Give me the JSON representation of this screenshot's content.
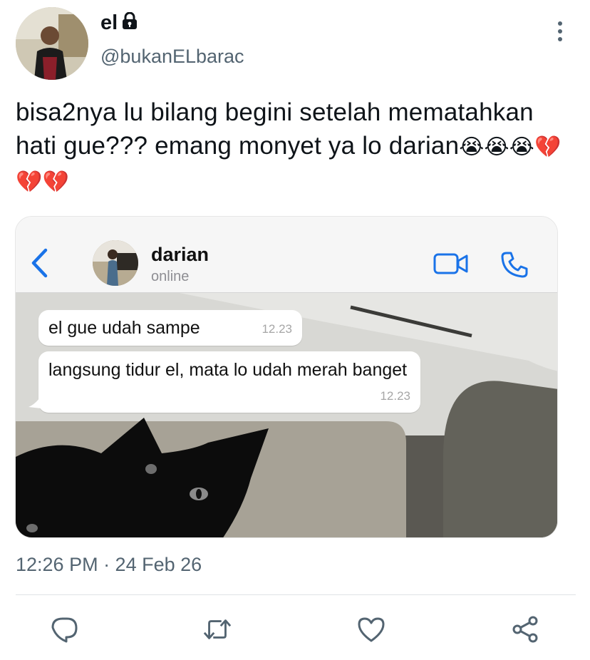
{
  "user": {
    "display_name": "el",
    "handle": "@bukanELbarac"
  },
  "tweet": {
    "text": "bisa2nya lu bilang begini setelah mematahkan hati gue??? emang monyet ya lo darian",
    "emojis": "😭😭😭💔💔💔",
    "timestamp": "12:26 PM · 24 Feb 26"
  },
  "media": {
    "contact_name": "darian",
    "contact_status": "online",
    "messages": [
      {
        "text": "el gue udah sampe",
        "time": "12.23"
      },
      {
        "text": "langsung tidur el, mata lo udah merah banget",
        "time": "12.23"
      }
    ]
  },
  "icons": {
    "lock": "lock-icon",
    "more": "more-vertical-icon",
    "back": "chevron-left-icon",
    "video": "video-camera-icon",
    "call": "phone-icon",
    "reply": "reply-icon",
    "retweet": "retweet-icon",
    "like": "heart-icon",
    "share": "share-icon"
  },
  "colors": {
    "text": "#0f1419",
    "secondary": "#536471",
    "whatsapp_blue": "#1a73e8",
    "action_icon": "#536471"
  }
}
